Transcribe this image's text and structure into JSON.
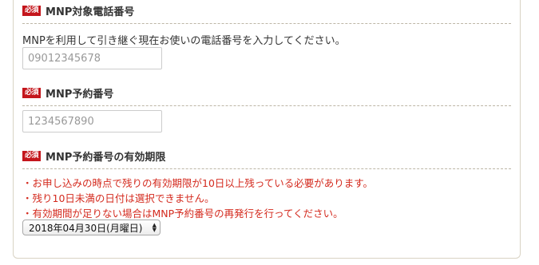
{
  "required_badge": "必須",
  "sections": [
    {
      "title": "MNP対象電話番号",
      "description": "MNPを利用して引き継ぐ現在お使いの電話番号を入力してください。",
      "placeholder": "09012345678"
    },
    {
      "title": "MNP予約番号",
      "placeholder": "1234567890"
    },
    {
      "title": "MNP予約番号の有効期限",
      "warnings": [
        "・お申し込みの時点で残りの有効期限が10日以上残っている必要があります。",
        "・残り10日未満の日付は選択できません。",
        "・有効期間が足りない場合はMNP予約番号の再発行を行ってください。"
      ],
      "selected_date": "2018年04月30日(月曜日)"
    }
  ],
  "colors": {
    "required_badge": "#c4161c",
    "warning_text": "#d42a1e",
    "panel_border": "#d9d3c4"
  }
}
